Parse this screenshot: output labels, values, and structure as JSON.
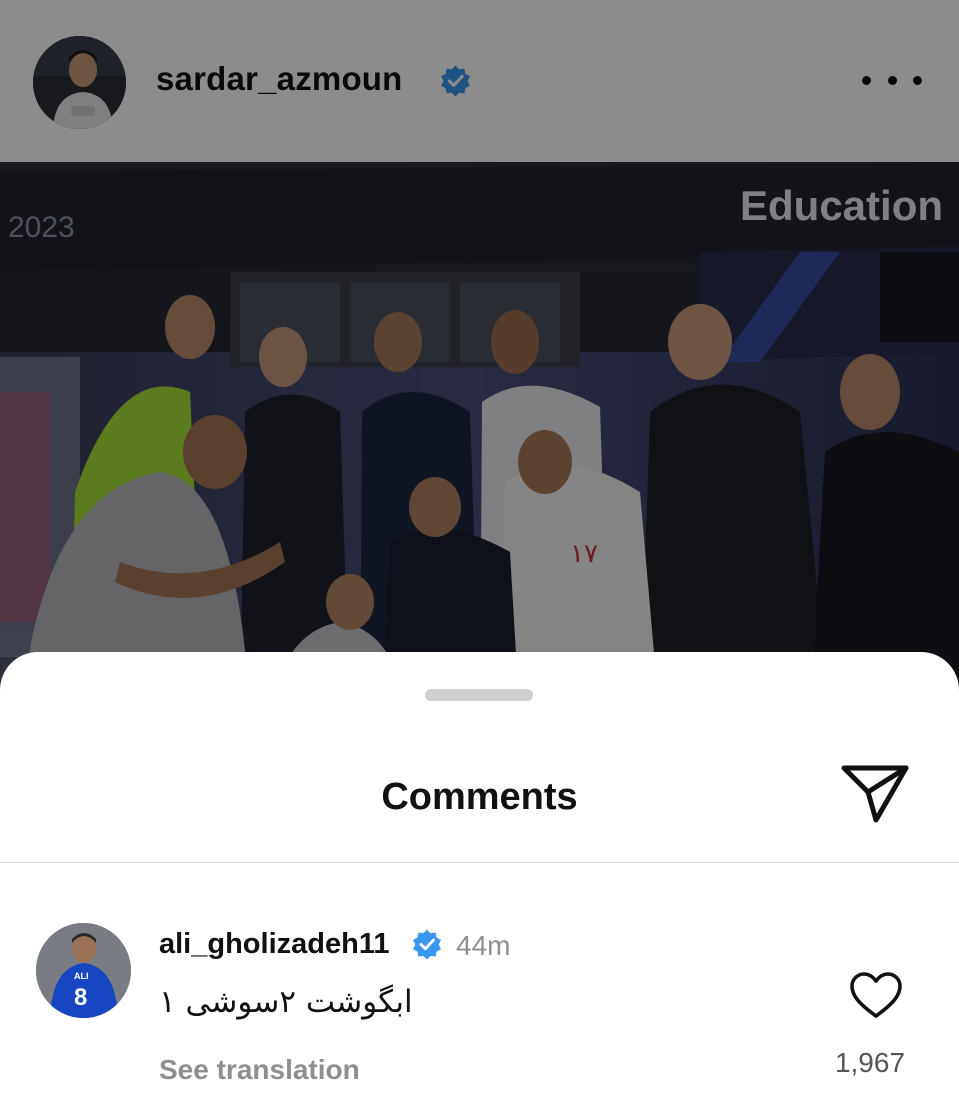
{
  "post": {
    "username": "sardar_azmoun",
    "verified": true,
    "photo_caption_text": "Education",
    "photo_year_text": "2023"
  },
  "comments_sheet": {
    "title": "Comments",
    "comments": [
      {
        "username": "ali_gholizadeh11",
        "verified": true,
        "time": "44m",
        "text": "ابگوشت ۲سوشی ۱",
        "see_translation": "See translation",
        "like_count": "1,967",
        "avatar_jersey_name": "ALI",
        "avatar_jersey_number": "8"
      }
    ]
  },
  "colors": {
    "verified_blue": "#3897f0",
    "text_primary": "#111111",
    "text_secondary": "#8e8e8e"
  },
  "icons": {
    "more": "ellipsis-horizontal-icon",
    "share": "paper-plane-icon",
    "like": "heart-outline-icon",
    "verified": "verified-badge-icon"
  }
}
